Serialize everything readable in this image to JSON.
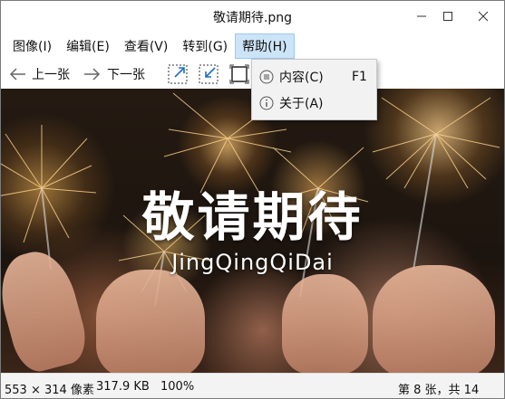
{
  "window": {
    "title": "敬请期待.png"
  },
  "menubar": {
    "items": [
      {
        "label": "图像(I)"
      },
      {
        "label": "编辑(E)"
      },
      {
        "label": "查看(V)"
      },
      {
        "label": "转到(G)"
      },
      {
        "label": "帮助(H)"
      }
    ]
  },
  "toolbar": {
    "prev_label": "上一张",
    "next_label": "下一张"
  },
  "help_menu": {
    "items": [
      {
        "label": "内容(C)",
        "shortcut": "F1",
        "icon": "list-circle-icon"
      },
      {
        "label": "关于(A)",
        "shortcut": "",
        "icon": "info-circle-icon"
      }
    ]
  },
  "image": {
    "headline": "敬请期待",
    "subline": "JingQingQiDai"
  },
  "statusbar": {
    "dimensions": "553 × 314 像素",
    "filesize": "317.9 KB",
    "zoom": "100%",
    "position": "第 8 张，共 14"
  },
  "colors": {
    "menu_highlight": "#cce4f7",
    "menu_border": "#99c9ef"
  }
}
